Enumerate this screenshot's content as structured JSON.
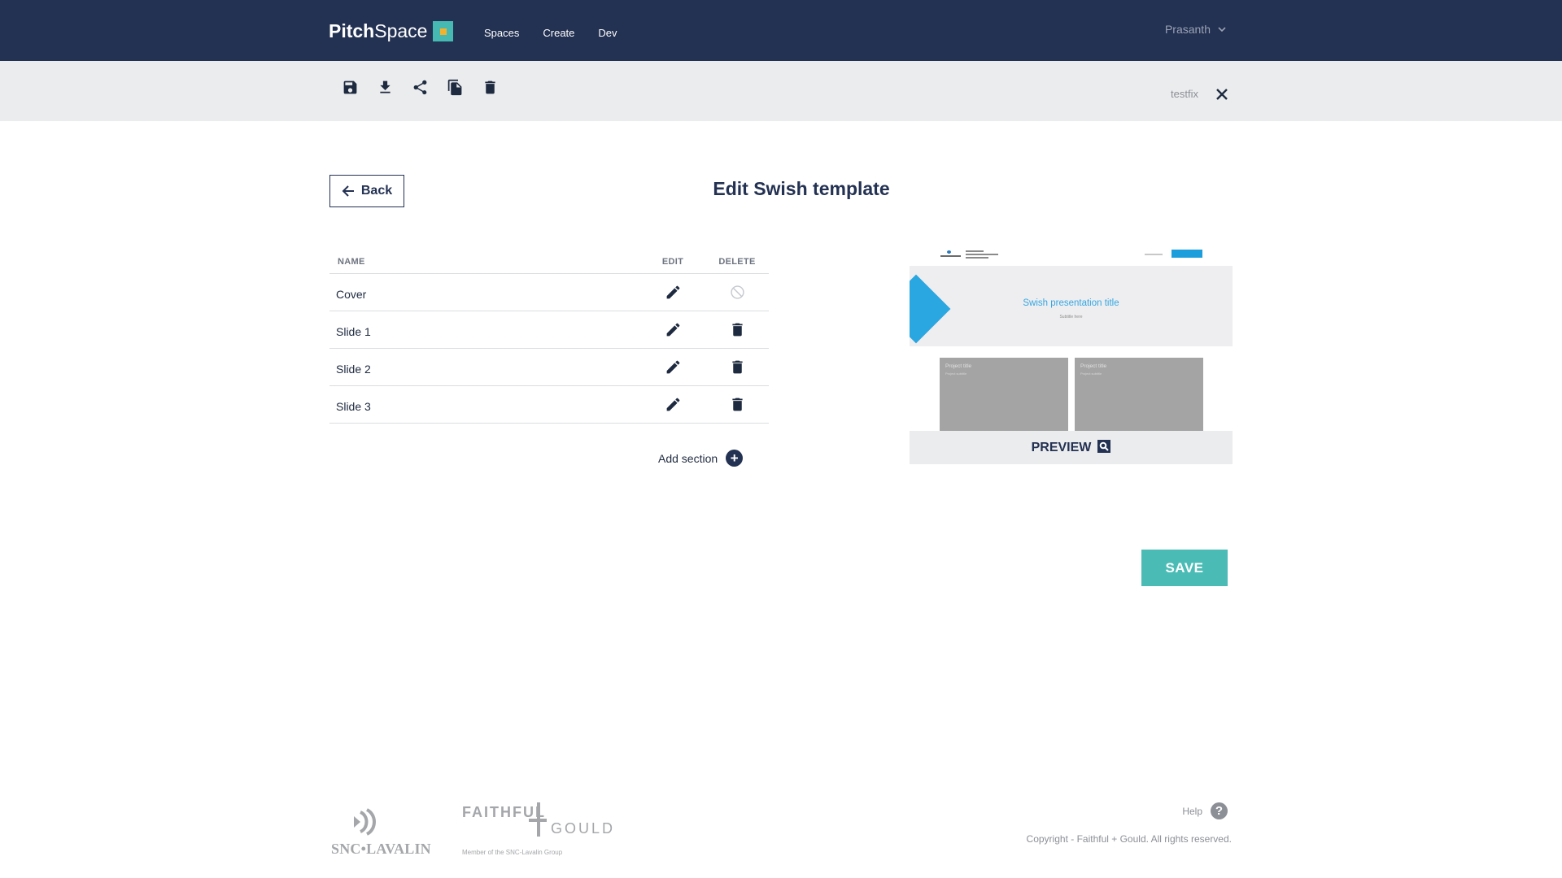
{
  "brand": {
    "name_bold": "Pitch",
    "name_light": "Space"
  },
  "nav": {
    "items": [
      {
        "label": "Spaces"
      },
      {
        "label": "Create"
      },
      {
        "label": "Dev"
      }
    ]
  },
  "user": {
    "name": "Prasanth",
    "icon": "chevron-down-icon"
  },
  "toolbar": {
    "tools": [
      {
        "name": "save-icon"
      },
      {
        "name": "download-icon"
      },
      {
        "name": "share-icon"
      },
      {
        "name": "copy-icon"
      },
      {
        "name": "delete-icon"
      }
    ],
    "doc_name": "testfix",
    "close_icon": "close-icon"
  },
  "page": {
    "back_label": "Back",
    "title": "Edit Swish template"
  },
  "table": {
    "headers": {
      "name": "NAME",
      "edit": "EDIT",
      "delete": "DELETE"
    },
    "rows": [
      {
        "name": "Cover",
        "deletable": false
      },
      {
        "name": "Slide 1",
        "deletable": true
      },
      {
        "name": "Slide 2",
        "deletable": true
      },
      {
        "name": "Slide 3",
        "deletable": true
      }
    ],
    "add_section_label": "Add section"
  },
  "preview": {
    "slide_title": "Swish presentation title",
    "slide_subtitle": "Subtitle here",
    "card1_title": "Project title",
    "card1_sub": "Project subtitle",
    "card2_title": "Project title",
    "card2_sub": "Project subtitle",
    "button_label": "PREVIEW",
    "accent_color": "#2aa6e0"
  },
  "save_label": "SAVE",
  "footer": {
    "snc_logo": "SNC•LAVALIN",
    "fg_logo_top": "FAITHFUL",
    "fg_logo_bottom": "GOULD",
    "fg_member": "Member of the SNC-Lavalin Group",
    "help_label": "Help",
    "copyright": "Copyright - Faithful + Gould. All rights reserved."
  },
  "colors": {
    "navy": "#233152",
    "teal": "#4bbcb5",
    "toolbar_bg": "#ebecee"
  }
}
